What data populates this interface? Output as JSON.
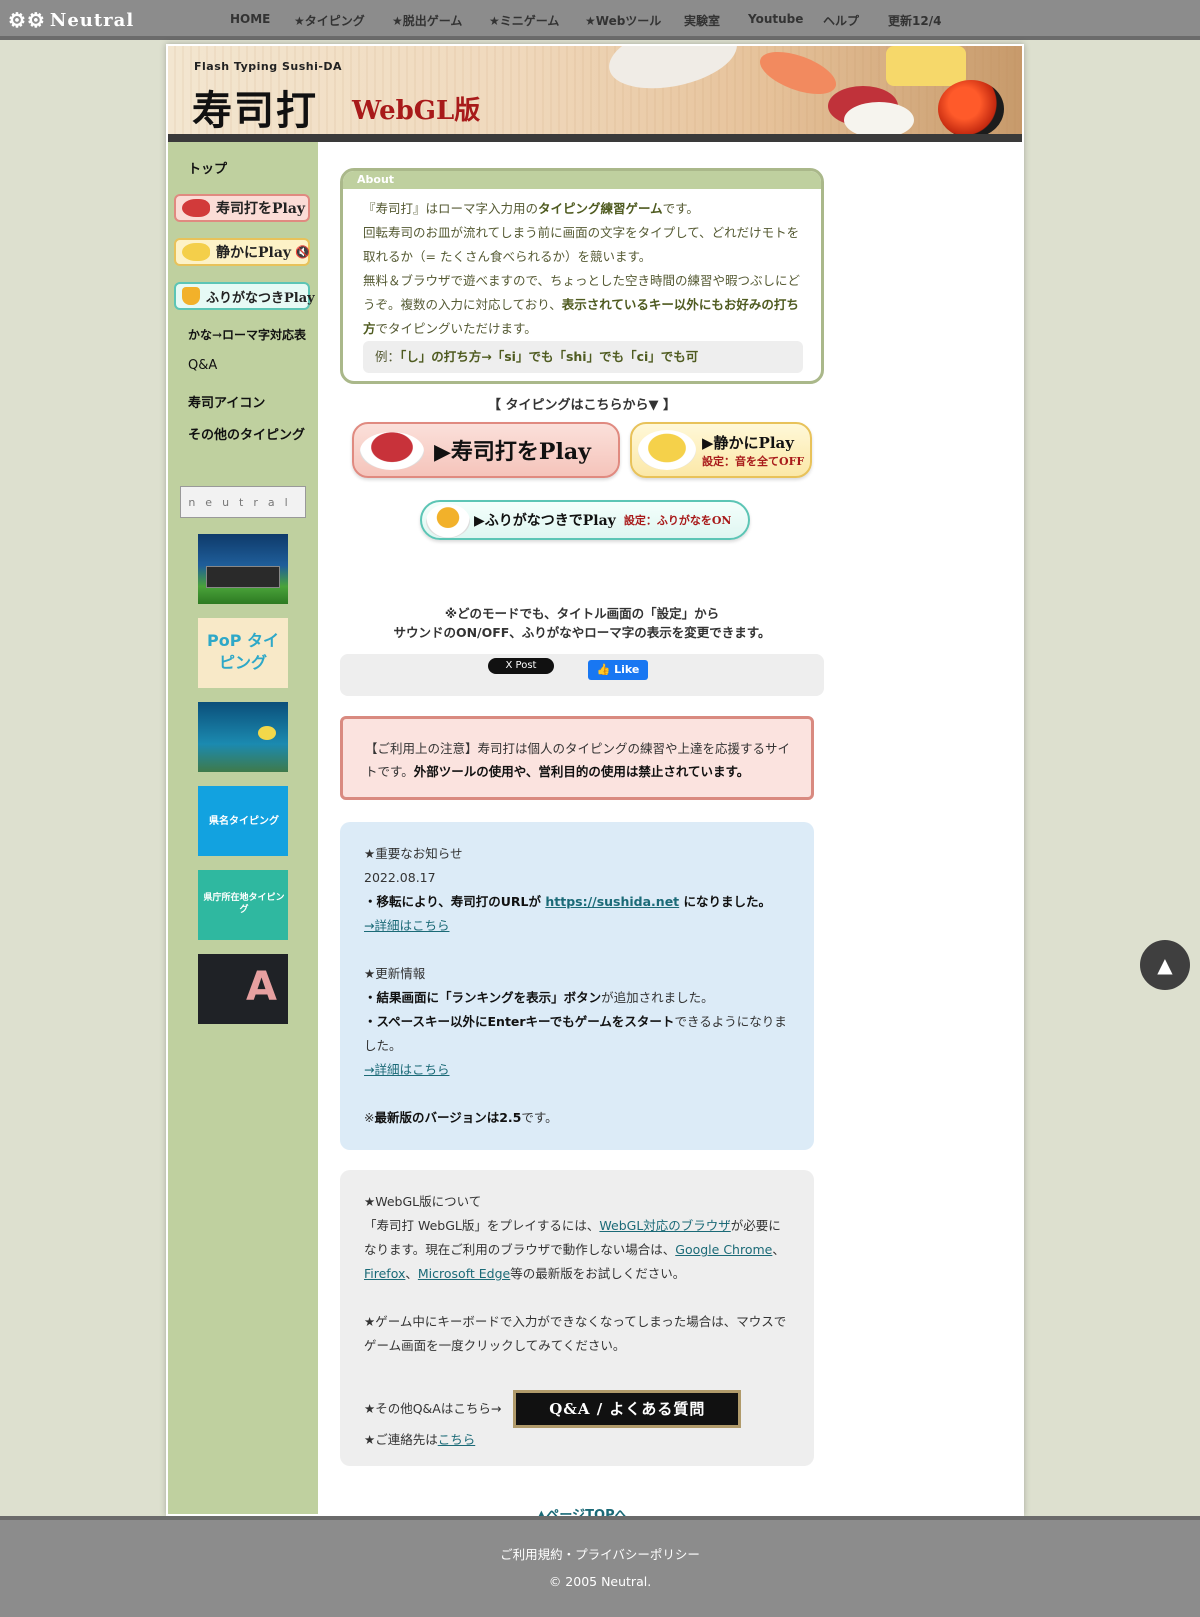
{
  "brand": {
    "name": "Neutral",
    "icon": "gears-icon"
  },
  "nav": [
    {
      "label": "HOME"
    },
    {
      "label": "★タイピング"
    },
    {
      "label": "★脱出ゲーム"
    },
    {
      "label": "★ミニゲーム"
    },
    {
      "label": "★Webツール"
    },
    {
      "label": "実験室"
    },
    {
      "label": "Youtube"
    },
    {
      "label": "ヘルプ"
    },
    {
      "label": "更新12/4"
    }
  ],
  "banner": {
    "subtitle": "Flash Typing Sushi-DA",
    "title": "寿司打",
    "version": "WebGL版"
  },
  "sidebar": {
    "top": "トップ",
    "play": "寿司打をPlay",
    "quiet": "静かにPlay",
    "furigana": "ふりがなつきPlay",
    "kana_table": "かな→ローマ字対応表",
    "qa": "Q&A",
    "icon": "寿司アイコン",
    "other": "その他のタイピング",
    "badge": "neutral",
    "thumbs": [
      {
        "name": "keyboard-typing-thumb",
        "label": ""
      },
      {
        "name": "pop-typing-thumb",
        "label": "PoP タイピング"
      },
      {
        "name": "aquarium-thumb",
        "label": ""
      },
      {
        "name": "prefecture-typing-thumb",
        "label": "県名タイピング"
      },
      {
        "name": "prefecture-capital-thumb",
        "label": "県庁所在地タイピング"
      },
      {
        "name": "alphabet-thumb",
        "label": "A"
      }
    ]
  },
  "about": {
    "tab": "About",
    "p1_a": "『寿司打』はローマ字入力用の",
    "p1_b": "タイピング練習ゲーム",
    "p1_c": "です。",
    "p2": "回転寿司のお皿が流れてしまう前に画面の文字をタイプして、どれだけモトを取れるか（= たくさん食べられるか）を競います。",
    "p3_a": "無料＆ブラウザで遊べますので、ちょっとした空き時間の練習や暇つぶしにどうぞ。複数の入力に対応しており、",
    "p3_b": "表示されているキー以外にもお好みの打ち方",
    "p3_c": "でタイピングいただけます。",
    "example_a": "例：",
    "example_b": "「し」の打ち方→「si」でも「shi」でも「ci」でも可"
  },
  "typing_head": "【 タイピングはこちらから▼ 】",
  "buttons": {
    "play": "▶寿司打をPlay",
    "quiet": "▶静かにPlay",
    "quiet_note": "設定：音を全てOFF",
    "furigana": "▶ふりがなつきでPlay",
    "furigana_note": "設定：ふりがなをON"
  },
  "mode_note": {
    "line1": "※どのモードでも、タイトル画面の「設定」から",
    "line2": "サウンドのON/OFF、ふりがなやローマ字の表示を変更できます。"
  },
  "social": {
    "x": "X Post",
    "fb": "👍 Like"
  },
  "notice": {
    "a": "【ご利用上の注意】寿司打は個人のタイピングの練習や上達を応援するサイトです。",
    "b": "外部ツールの使用や、営利目的の使用は禁止されています。"
  },
  "news": {
    "title": "★重要なお知らせ",
    "date": "2022.08.17",
    "move_a": "・移転により、寿司打のURLが ",
    "move_link": "https://sushida.net",
    "move_b": " になりました。",
    "details1": "→詳細はこちら",
    "update_title": "★更新情報",
    "u1_a": "・結果画面に「ランキングを表示」ボタン",
    "u1_b": "が追加されました。",
    "u2_a": "・スペースキー以外にEnterキーでもゲームをスタート",
    "u2_b": "できるようになりました。",
    "details2": "→詳細はこちら",
    "version_a": "※",
    "version_b": "最新版のバージョンは2.5",
    "version_c": "です。"
  },
  "webgl": {
    "title": "★WebGL版について",
    "a": "「寿司打 WebGL版」をプレイするには、",
    "link1": "WebGL対応のブラウザ",
    "b": "が必要になります。現在ご利用のブラウザで動作しない場合は、",
    "link2": "Google Chrome",
    "sep1": "、",
    "link3": "Firefox",
    "sep2": "、",
    "link4": "Microsoft Edge",
    "c": "等の最新版をお試しください。",
    "keyboard": "★ゲーム中にキーボードで入力ができなくなってしまった場合は、マウスでゲーム画面を一度クリックしてみてください。",
    "qa_label": "★その他Q&Aはこちら→",
    "qa_button": "Q&A / よくある質問",
    "contact_a": "★ご連絡先は",
    "contact_link": "こちら"
  },
  "pagetop": "▲ページTOPへ",
  "scrolltop": "▲",
  "footer": {
    "links": "ご利用規約・プライバシーポリシー",
    "copyright": "© 2005 Neutral."
  }
}
